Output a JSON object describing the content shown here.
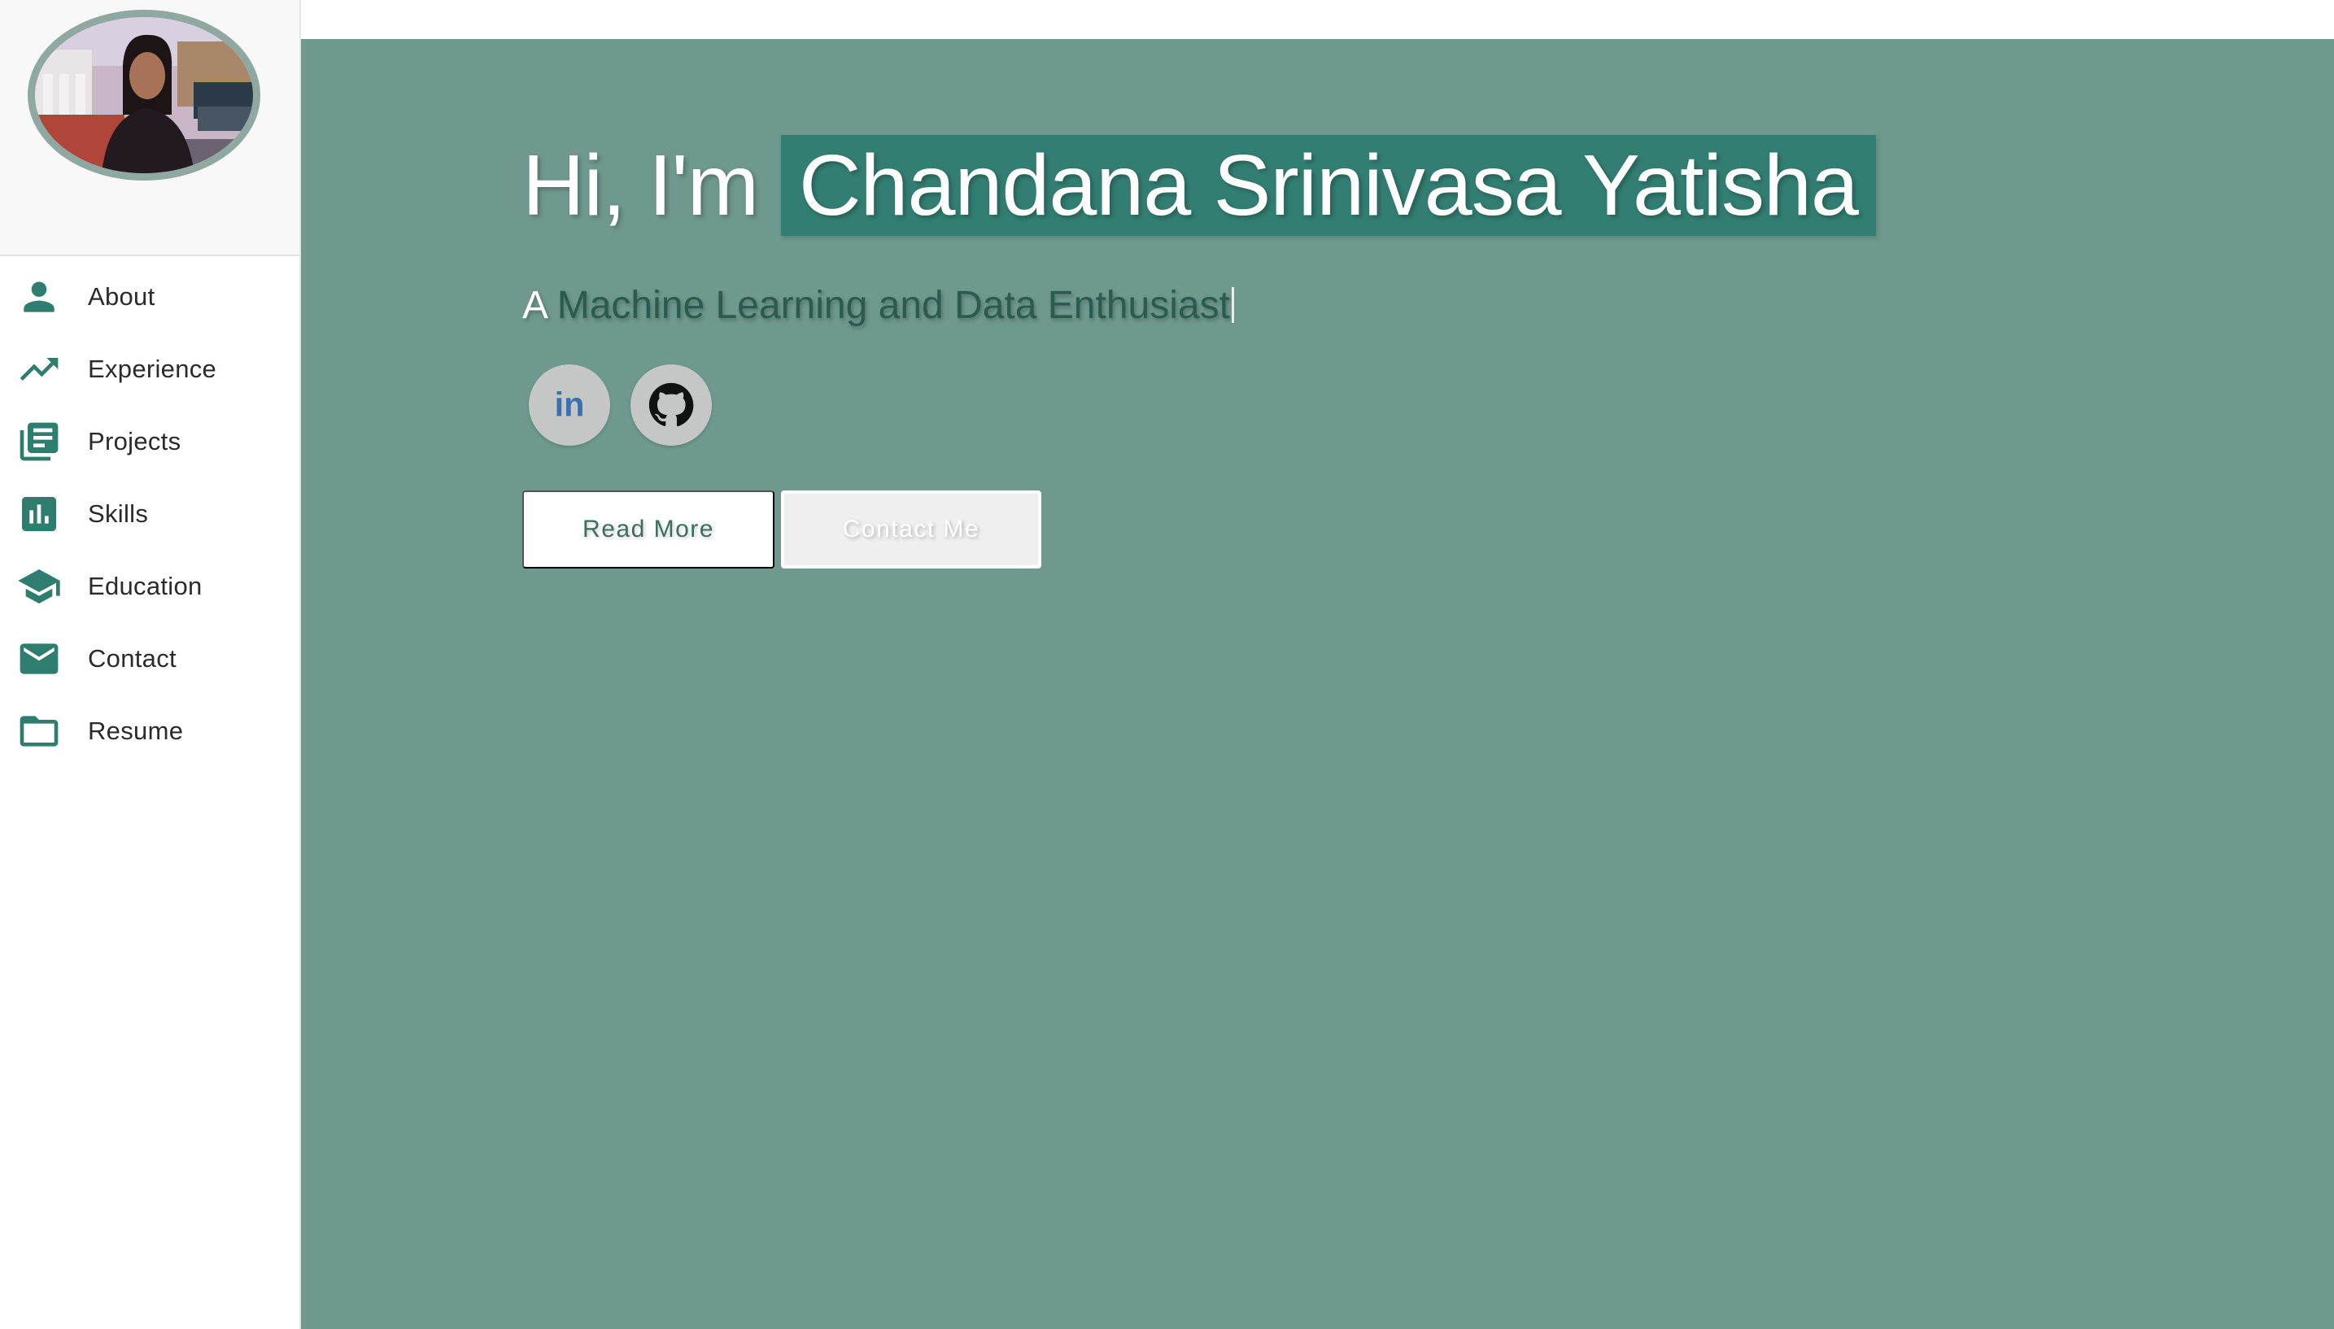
{
  "colors": {
    "accent": "#2e7d6e",
    "hero_background": "#6f998e",
    "name_highlight": "#337e72",
    "sidebar_background": "#ffffff"
  },
  "sidebar": {
    "avatar": "profile-photo",
    "items": [
      {
        "label": "About",
        "icon": "person-icon"
      },
      {
        "label": "Experience",
        "icon": "trending-up-icon"
      },
      {
        "label": "Projects",
        "icon": "library-books-icon"
      },
      {
        "label": "Skills",
        "icon": "bar-chart-icon"
      },
      {
        "label": "Education",
        "icon": "school-icon"
      },
      {
        "label": "Contact",
        "icon": "mail-icon"
      },
      {
        "label": "Resume",
        "icon": "folder-icon"
      }
    ]
  },
  "hero": {
    "greeting_prefix": "Hi, I'm",
    "name": "Chandana Srinivasa Yatisha",
    "tagline_prefix": "A",
    "tagline_typed": "Machine Learning and Data Enthusiast",
    "social": [
      {
        "label": "in",
        "icon": "linkedin-icon"
      },
      {
        "icon": "github-icon"
      }
    ],
    "buttons": {
      "read_more": "Read More",
      "contact_me": "Contact Me"
    }
  }
}
